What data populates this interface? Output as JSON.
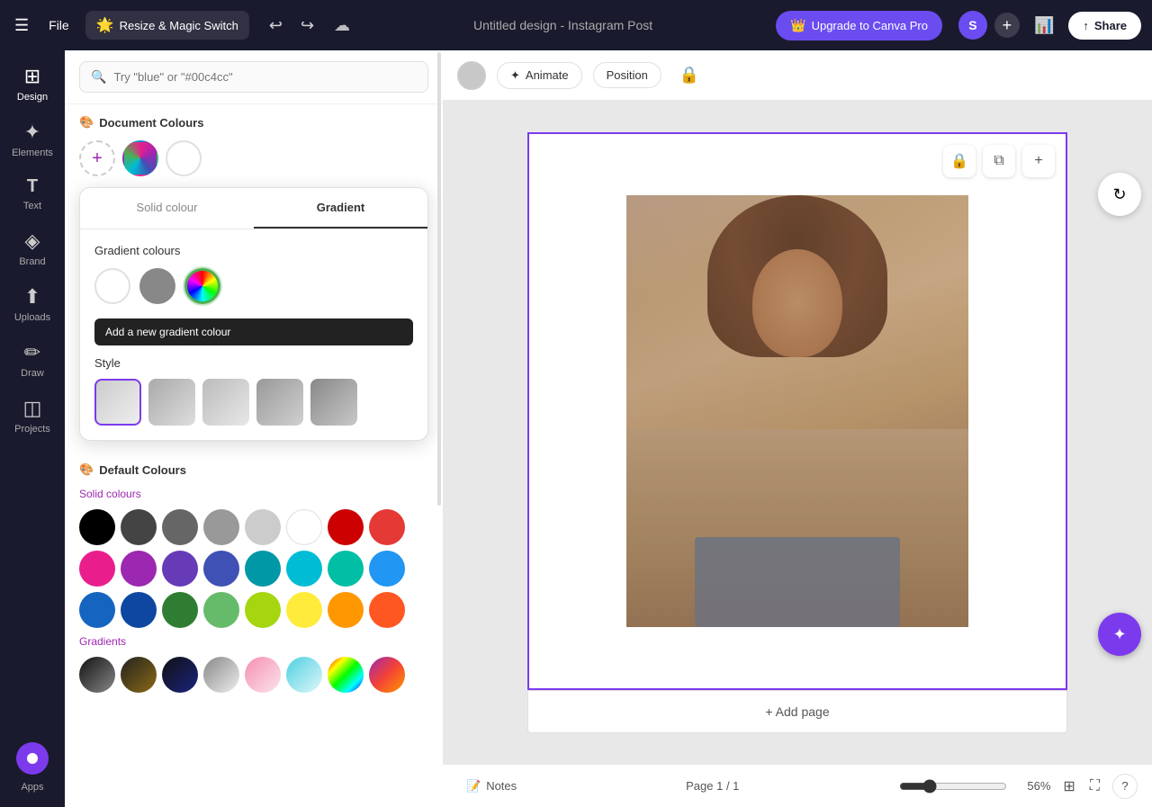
{
  "topbar": {
    "menu_icon": "☰",
    "file_label": "File",
    "magic_switch_label": "Resize & Magic Switch",
    "magic_emoji": "🌟",
    "undo_icon": "↩",
    "redo_icon": "↪",
    "save_icon": "☁",
    "title": "Untitled design - Instagram Post",
    "upgrade_label": "Upgrade to Canva Pro",
    "upgrade_icon": "👑",
    "avatar_letter": "S",
    "plus_icon": "+",
    "chart_icon": "📊",
    "share_icon": "↑",
    "share_label": "Share"
  },
  "sidebar": {
    "items": [
      {
        "id": "design",
        "label": "Design",
        "icon": "⊞"
      },
      {
        "id": "elements",
        "label": "Elements",
        "icon": "✦"
      },
      {
        "id": "text",
        "label": "Text",
        "icon": "T"
      },
      {
        "id": "brand",
        "label": "Brand",
        "icon": "◈"
      },
      {
        "id": "uploads",
        "label": "Uploads",
        "icon": "⬆"
      },
      {
        "id": "draw",
        "label": "Draw",
        "icon": "✏"
      },
      {
        "id": "projects",
        "label": "Projects",
        "icon": "◫"
      },
      {
        "id": "apps",
        "label": "Apps",
        "icon": "⊙"
      }
    ]
  },
  "panel": {
    "search_placeholder": "Try \"blue\" or \"#00c4cc\"",
    "document_colours_title": "Document Colours",
    "colour_popup": {
      "tab_solid": "Solid colour",
      "tab_gradient": "Gradient",
      "gradient_colours_label": "Gradient colours",
      "swatches": [
        {
          "id": "white",
          "color": "#ffffff",
          "selected": false
        },
        {
          "id": "gray",
          "color": "#888888",
          "selected": false
        }
      ],
      "add_tooltip": "Add a new gradient colour",
      "styles_label": "Style",
      "style_swatches": [
        {
          "id": "s1",
          "selected": true,
          "class": "gs-gray-white"
        },
        {
          "id": "s2",
          "selected": false,
          "class": "gs-gray-white"
        },
        {
          "id": "s3",
          "selected": false,
          "class": "gs-gray-white"
        },
        {
          "id": "s4",
          "selected": false,
          "class": "gs-gray-white"
        },
        {
          "id": "s5",
          "selected": false,
          "class": "gs-gray-white"
        }
      ]
    },
    "default_colours_title": "Default Colours",
    "solid_colours_label": "Solid colours",
    "solid_colours": [
      "#000000",
      "#444444",
      "#666666",
      "#999999",
      "#cccccc",
      "#ffffff",
      "#cc0000",
      "#e53935",
      "#e91e8c",
      "#9c27b0",
      "#673ab7",
      "#3f51b5",
      "#0097a7",
      "#00bcd4",
      "#00bfa5",
      "#2196f3",
      "#1565c0",
      "#0d47a1",
      "#2e7d32",
      "#66bb6a",
      "#a5d610",
      "#ffeb3b",
      "#ff9800",
      "#ff5722",
      "#880000",
      "#4caf50",
      "#b2ff59",
      "#ffe000",
      "#ffa726",
      "#ff6d00"
    ],
    "gradients_label": "Gradients",
    "gradient_colours": [
      "gs-black-gray",
      "gs-dark-gold",
      "gs-dark-blue",
      "gs-gray-white",
      "gs-pink-light",
      "gs-teal-light",
      "gs-rainbow1",
      "gs-rainbow2"
    ]
  },
  "secondary_toolbar": {
    "animate_label": "Animate",
    "position_label": "Position",
    "lock_icon": "🔒"
  },
  "canvas": {
    "add_page_label": "+ Add page",
    "top_controls": [
      {
        "id": "lock",
        "icon": "🔒"
      },
      {
        "id": "copy",
        "icon": "⧉"
      },
      {
        "id": "expand",
        "icon": "⊕"
      }
    ]
  },
  "bottom_bar": {
    "notes_icon": "📝",
    "notes_label": "Notes",
    "page_indicator": "Page 1 / 1",
    "zoom_percent": "56%",
    "help_icon": "?"
  }
}
